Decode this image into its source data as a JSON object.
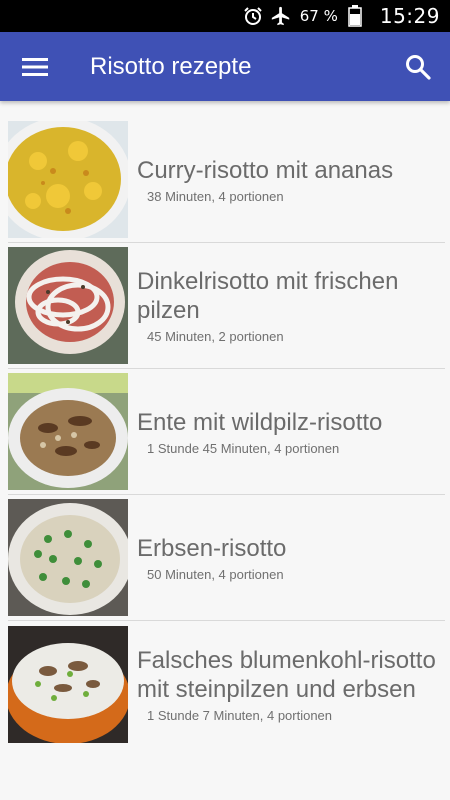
{
  "status_bar": {
    "battery_percent": "67 %",
    "time": "15:29",
    "icons": [
      "alarm-icon",
      "airplane-mode-icon",
      "battery-icon"
    ]
  },
  "app_bar": {
    "title": "Risotto rezepte",
    "menu_icon": "hamburger-menu-icon",
    "search_icon": "search-icon"
  },
  "recipes": [
    {
      "title": "Curry-risotto mit ananas",
      "meta": "38 Minuten, 4 portionen"
    },
    {
      "title": "Dinkelrisotto mit frischen pilzen",
      "meta": "45 Minuten, 2 portionen"
    },
    {
      "title": "Ente mit wildpilz-risotto",
      "meta": "1 Stunde 45 Minuten, 4 portionen"
    },
    {
      "title": "Erbsen-risotto",
      "meta": "50 Minuten, 4 portionen"
    },
    {
      "title": "Falsches blumenkohl-risotto mit steinpilzen und erbsen",
      "meta": "1 Stunde 7 Minuten, 4 portionen"
    }
  ]
}
